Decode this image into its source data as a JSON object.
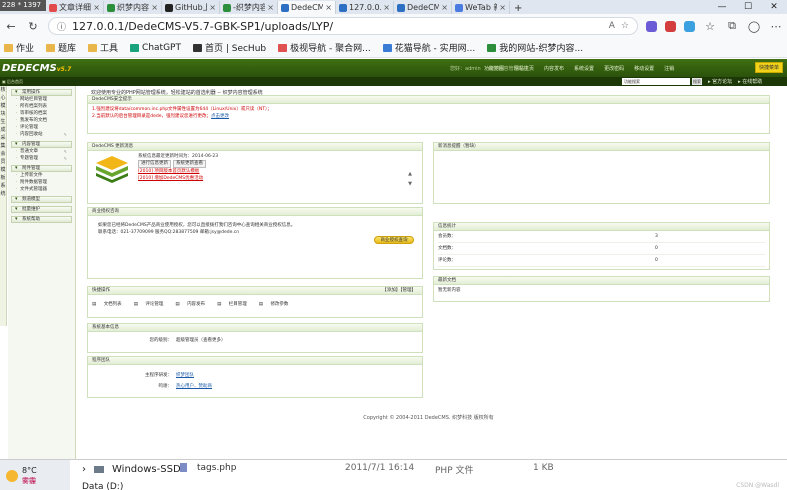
{
  "screen_badge": "228 * 1397",
  "tabs": [
    {
      "label": "文章详细",
      "color": "#e24b4b"
    },
    {
      "label": "织梦内容",
      "color": "#2d8f3c"
    },
    {
      "label": "GitHub上",
      "color": "#222222"
    },
    {
      "label": "-织梦内容",
      "color": "#2d8f3c"
    },
    {
      "label": "DedeCM",
      "color": "#2d6fc2"
    },
    {
      "label": "127.0.0.1",
      "color": "#2d6fc2"
    },
    {
      "label": "DedeCM",
      "color": "#2d6fc2"
    },
    {
      "label": "WeTab 新",
      "color": "#4a7be0"
    }
  ],
  "address": {
    "url": "127.0.0.1/DedeCMS-V5.7-GBK-SP1/uploads/LYP/"
  },
  "favorites": [
    {
      "label": "作业",
      "type": "folder"
    },
    {
      "label": "题库",
      "type": "folder"
    },
    {
      "label": "工具",
      "type": "folder"
    },
    {
      "label": "ChatGPT",
      "type": "site",
      "color": "#19a37d"
    },
    {
      "label": "首页 | SecHub",
      "type": "site",
      "color": "#333333"
    },
    {
      "label": "极视导航 - 聚合网...",
      "type": "site",
      "color": "#e05252"
    },
    {
      "label": "花猫导航 - 实用网...",
      "type": "site",
      "color": "#3a7bd5"
    },
    {
      "label": "我的网站-织梦内容...",
      "type": "site",
      "color": "#2d8f3c"
    }
  ],
  "cms": {
    "logo_main": "DEDECMS",
    "logo_ver": "v5.7",
    "top_links_dim": [
      "您好：admin",
      "织梦内容管理系统"
    ],
    "top_links": [
      "功能地图",
      "网站主页",
      "内容发布",
      "系统设置",
      "更改密码",
      "移动设置",
      "注销"
    ],
    "top_button": "快捷菜单",
    "sub_left": "▣ 后台首页",
    "search_value": "功能搜索",
    "search_go": "搜索",
    "sub_links": [
      "▸ 官方论坛",
      "▸ 在线帮助"
    ],
    "vtabs": [
      "核",
      "心",
      "模",
      "块",
      "生",
      "成",
      "采",
      "集",
      "会",
      "员",
      "模",
      "板",
      "系",
      "统"
    ],
    "sidebar": [
      {
        "section": "常用操作",
        "items": [
          "网站栏目管理",
          "所有档案列表",
          "等审核的档案",
          "我发布的文档",
          "评论管理",
          "内容回收站"
        ]
      },
      {
        "section": "内容管理",
        "items": [
          "普通文章",
          "专题管理"
        ]
      },
      {
        "section": "附件管理",
        "items": [
          "上传新文件",
          "附件数据管理",
          "文件式管理器"
        ]
      },
      {
        "section": "频道模型",
        "items": []
      },
      {
        "section": "批量维护",
        "items": []
      },
      {
        "section": "系统帮助",
        "items": []
      }
    ],
    "welcome": "欢迎使用专业的PHP网站管理系统，轻松建站的首选利器 -- 织梦内容管理系统",
    "security": {
      "title": "DedeCMS安全提示",
      "line1": "1.强烈建议将data/common.inc.php文件属性设置为644（Linux/Unix）或只读（NT）；",
      "line2": "2.当前默认的后台管理目录是dede，强烈建议您进行更改；",
      "line2_link": "点击更改"
    },
    "update": {
      "title": "DedeCMS 更新消息",
      "heading": "系统信息最近更新时间为：2014-06-23",
      "btn1": "进行信息更新",
      "btn2": "系统更新查看",
      "news": [
        "[2010] 项目版本首页默认模板",
        "[2010] 增加DedeCMS优惠活动"
      ]
    },
    "business": {
      "title": "商业授权咨询",
      "line1": "如果您已经将DedeCMS产品商业使用授权，您可以直接拨打我们咨询中心查询相关商业授权信息。",
      "line2": "联系电话：021-37709099 服务QQ:283877509 邮箱:jsy@dede.cn",
      "button": "商业授权查询"
    },
    "quick": {
      "title": "快捷操作",
      "actions": "【添加】【管理】",
      "links": [
        "文档列表",
        "评论管理",
        "内容发布",
        "栏目管理",
        "修改参数"
      ]
    },
    "sysinfo": {
      "title": "系统基本信息",
      "label": "您的级别：",
      "value": "超级管理员（查看更多）"
    },
    "team": {
      "title": "程序团队",
      "row1_label": "主程序研发：",
      "row1_value": "织梦团队",
      "row2_label": "鸣谢：",
      "row2_value": "热心用户、赞助商"
    },
    "right_top": {
      "title": "新消息提醒（暂缺）"
    },
    "stats": {
      "title": "信息统计",
      "rows": [
        {
          "k": "会员数：",
          "v": "3"
        },
        {
          "k": "文档数：",
          "v": "0"
        },
        {
          "k": "评论数：",
          "v": "0"
        }
      ]
    },
    "recent": {
      "title": "最新文档",
      "empty": "暂无新内容"
    },
    "footer": "Copyright © 2004-2011 DedeCMS. 织梦科技 版权所有"
  },
  "explorer": {
    "temp": "8°C",
    "cond": "雾霾",
    "folder1": "Windows-SSD",
    "folder2": "Data (D:)",
    "file_name": "tags.php",
    "file_date": "2011/7/1 16:14",
    "file_type": "PHP 文件",
    "file_size": "1 KB",
    "watermark": "CSDN @Wasdl"
  }
}
